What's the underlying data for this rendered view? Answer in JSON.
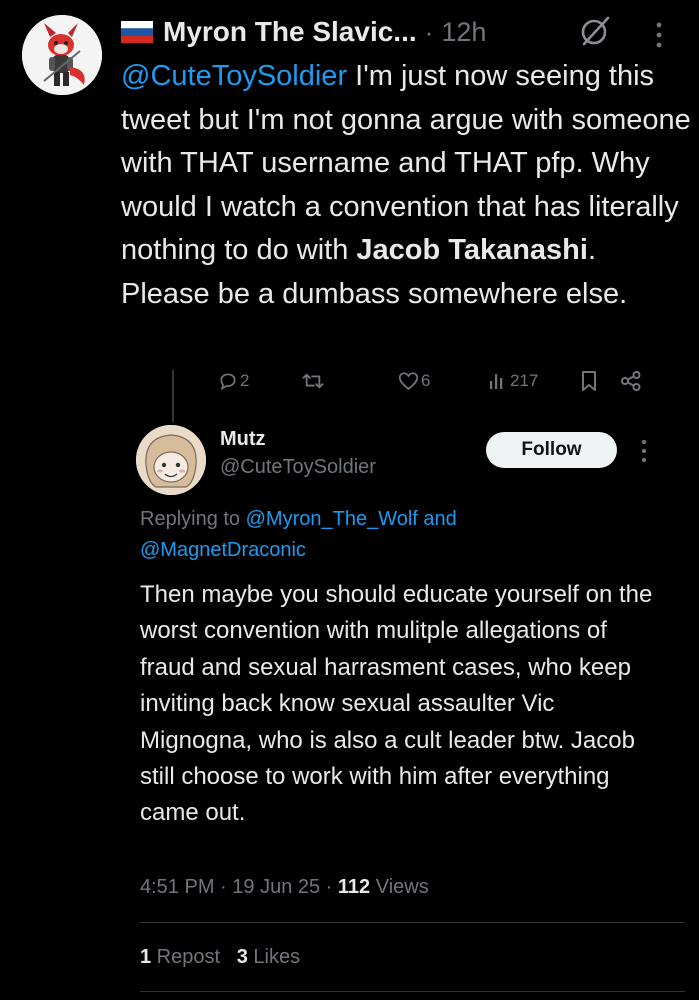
{
  "tweet": {
    "author_name": "Myron The Slavic...",
    "separator": "·",
    "time": "12h",
    "body": {
      "mention": "@CuteToySoldier",
      "text_a": " I'm just now seeing this tweet but I'm not gonna argue with someone with THAT username and THAT pfp. Why would I watch a convention that has literally nothing to do with ",
      "bold": "Jacob Takanashi",
      "text_b": ". Please be a dumbass somewhere else."
    },
    "actions": {
      "replies": "2",
      "likes": "6",
      "views": "217"
    },
    "icons": {
      "flag": "russian-flag-icon",
      "grok": "grok-icon",
      "more": "more-vertical-icon",
      "reply": "reply-icon",
      "repost": "repost-icon",
      "like": "heart-icon",
      "views": "views-icon",
      "bookmark": "bookmark-icon",
      "share": "share-icon"
    }
  },
  "quoted": {
    "name": "Mutz",
    "handle": "@CuteToySoldier",
    "follow_label": "Follow",
    "replying_prefix": "Replying to ",
    "replying_to_1": "@Myron_The_Wolf",
    "replying_and": " and",
    "replying_to_2": "@MagnetDraconic",
    "body": "Then maybe you should educate yourself on the worst convention with mulitple allegations of fraud and sexual harrasment cases, who keep inviting back know sexual assaulter Vic Mignogna, who is also a cult leader btw. Jacob still choose to work with him after everything came out.",
    "time": "4:51 PM",
    "sep1": " · ",
    "date": "19 Jun 25",
    "sep2": " · ",
    "views_count": "112",
    "views_label": " Views",
    "reposts_count": "1",
    "reposts_label": " Repost",
    "likes_count": "3",
    "likes_label": " Likes"
  },
  "colors": {
    "background": "#000000",
    "text": "#e7e9ea",
    "muted": "#71767b",
    "accent": "#1d9bf0",
    "follow_bg": "#eff3f4"
  }
}
